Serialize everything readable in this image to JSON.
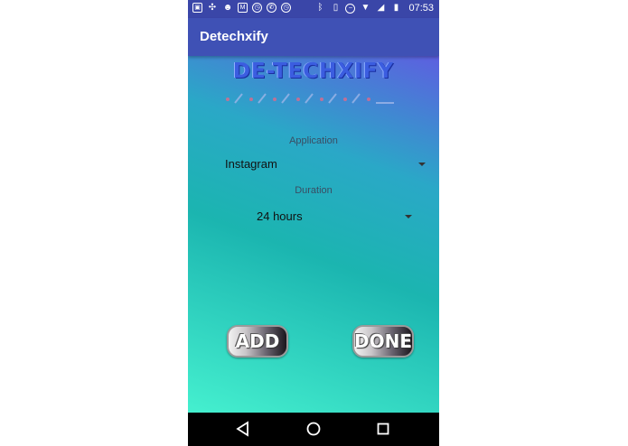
{
  "status_bar": {
    "left_icons": [
      "gallery-icon",
      "slack-icon",
      "snapchat-icon",
      "gmail-icon",
      "alarm-icon",
      "whatsapp-icon",
      "alarm-icon"
    ],
    "right_icons": [
      "bluetooth-icon",
      "vibrate-icon",
      "do-not-disturb-icon",
      "wifi-icon",
      "signal-icon",
      "battery-icon"
    ],
    "time": "07:53"
  },
  "app_bar": {
    "title": "Detechxify",
    "color": "#3f51b5"
  },
  "logo": {
    "text": "DE-TECHXIFY"
  },
  "form": {
    "application_label": "Application",
    "application_value": "Instagram",
    "duration_label": "Duration",
    "duration_value": "24 hours"
  },
  "buttons": {
    "add_label": "ADD",
    "done_label": "DONE"
  },
  "nav_bar": {
    "icons": [
      "back-icon",
      "home-icon",
      "recents-icon"
    ]
  }
}
